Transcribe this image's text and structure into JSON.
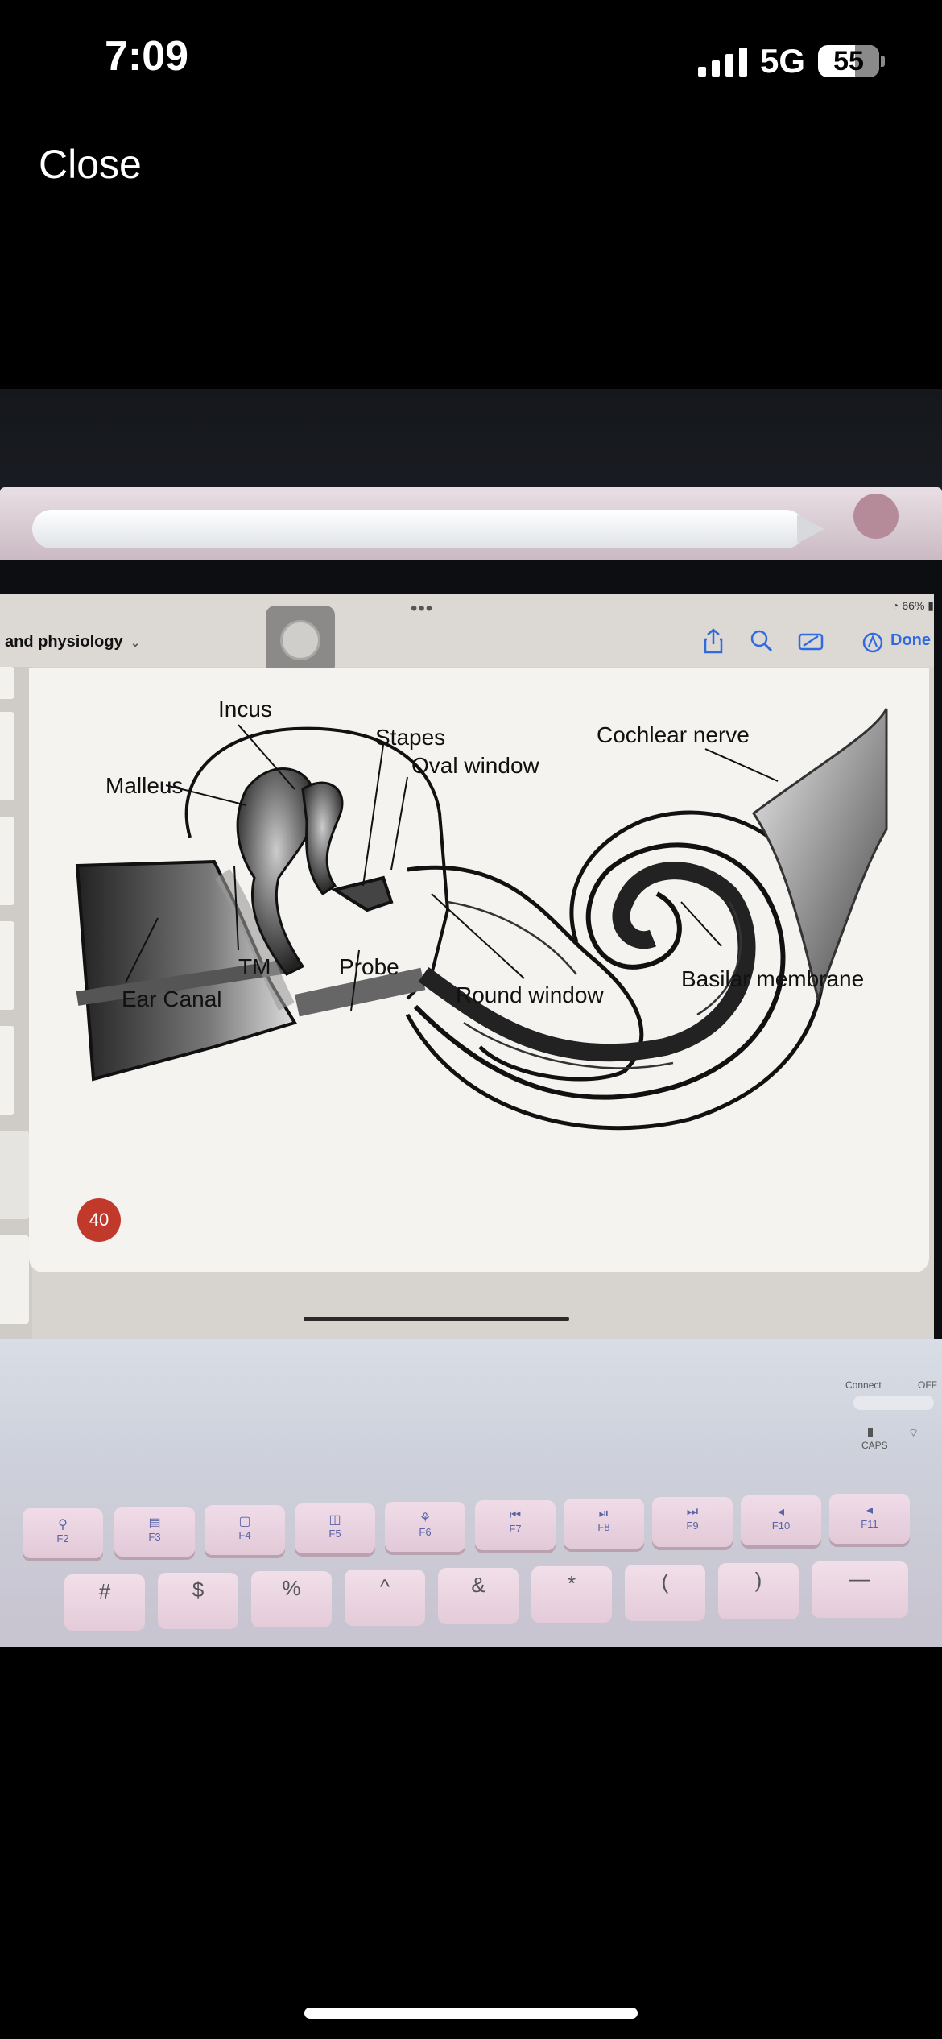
{
  "status_bar": {
    "time": "7:09",
    "network": "5G",
    "battery": "55"
  },
  "viewer": {
    "close_label": "Close"
  },
  "ipad": {
    "doc_title": "and physiology",
    "mini_status": "66%",
    "done_label": "Done",
    "page_number": "40",
    "accent_color": "#2f6ae0"
  },
  "diagram": {
    "labels": {
      "incus": "Incus",
      "stapes": "Stapes",
      "cochlear_nerve": "Cochlear nerve",
      "oval_window": "Oval window",
      "malleus": "Malleus",
      "tm": "TM",
      "probe": "Probe",
      "ear_canal": "Ear Canal",
      "round_window": "Round window",
      "basilar_membrane": "Basilar membrane"
    }
  },
  "keyboard": {
    "connect_label": "Connect",
    "off_label": "OFF",
    "caps_label": "CAPS",
    "fkeys": [
      "F2",
      "F3",
      "F4",
      "F5",
      "F6",
      "F7",
      "F8",
      "F9",
      "F10",
      "F11"
    ],
    "num_symbols": [
      "#",
      "$",
      "%",
      "^",
      "&",
      "*",
      "(",
      ")",
      "—"
    ]
  }
}
